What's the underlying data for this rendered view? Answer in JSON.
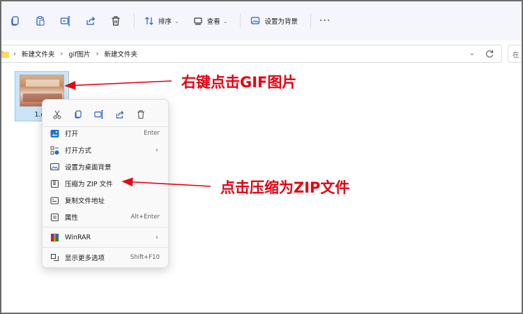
{
  "toolbar": {
    "sort_label": "排序",
    "view_label": "查看",
    "set_bg_label": "设置为背景",
    "more_label": "···",
    "icons": [
      "copy-icon",
      "paste-icon",
      "rename-icon",
      "share-icon",
      "delete-icon"
    ]
  },
  "address": {
    "crumbs": [
      "新建文件夹",
      "gif图片",
      "新建文件夹"
    ],
    "search_placeholder": "在"
  },
  "file": {
    "name": "1.gif"
  },
  "context_menu": {
    "quick_actions": [
      "cut-icon",
      "copy-icon",
      "rename-icon",
      "share-icon",
      "delete-icon"
    ],
    "items": [
      {
        "label": "打开",
        "shortcut": "Enter",
        "icon": "photos-icon"
      },
      {
        "label": "打开方式",
        "submenu": "›",
        "icon": "open-with-icon"
      },
      {
        "label": "设置为桌面背景",
        "icon": "wallpaper-icon"
      },
      {
        "label": "压缩为 ZIP 文件",
        "icon": "zip-icon"
      },
      {
        "label": "复制文件地址",
        "icon": "copy-path-icon"
      },
      {
        "label": "属性",
        "shortcut": "Alt+Enter",
        "icon": "properties-icon"
      },
      {
        "label": "WinRAR",
        "submenu": "›",
        "icon": "winrar-icon"
      },
      {
        "label": "显示更多选项",
        "shortcut": "Shift+F10",
        "icon": "more-options-icon"
      }
    ]
  },
  "annotations": {
    "right_click": "右键点击GIF图片",
    "click_zip": "点击压缩为ZIP文件"
  },
  "colors": {
    "annotation": "#e60012",
    "selection": "#cce4f7",
    "toolbar_bg": "#f4f6fb"
  }
}
